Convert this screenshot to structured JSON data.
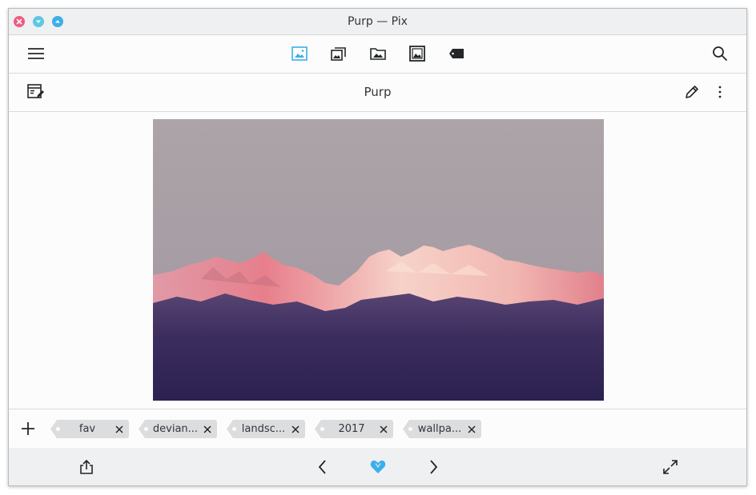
{
  "window": {
    "title": "Purp — Pix",
    "controls": [
      "close-icon",
      "minimize-icon",
      "maximize-icon"
    ]
  },
  "toolbar": {
    "menu_icon": "hamburger-menu-icon",
    "views": [
      {
        "icon": "image-viewer-icon",
        "active": true
      },
      {
        "icon": "gallery-icon",
        "active": false
      },
      {
        "icon": "folders-icon",
        "active": false
      },
      {
        "icon": "albums-icon",
        "active": false
      },
      {
        "icon": "tags-icon",
        "active": false
      }
    ],
    "search_icon": "search-icon",
    "accent_color": "#3daee9"
  },
  "subbar": {
    "title": "Purp",
    "left_icon": "image-info-icon",
    "edit_icon": "pencil-icon",
    "more_icon": "kebab-menu-icon"
  },
  "viewer": {
    "image": "mountain-range-photo",
    "colors": {
      "sky": "#aca4a8",
      "peaks": "#e0949a",
      "base": "#2b2150"
    }
  },
  "tags": {
    "add_icon": "plus-icon",
    "items": [
      {
        "label": "fav"
      },
      {
        "label": "devian..."
      },
      {
        "label": "landsc..."
      },
      {
        "label": "2017"
      },
      {
        "label": "wallpa..."
      }
    ]
  },
  "footer": {
    "share_icon": "share-icon",
    "prev_icon": "chevron-left-icon",
    "fav_icon": "heart-icon",
    "fav_active": true,
    "next_icon": "chevron-right-icon",
    "fullscreen_icon": "fullscreen-icon"
  }
}
